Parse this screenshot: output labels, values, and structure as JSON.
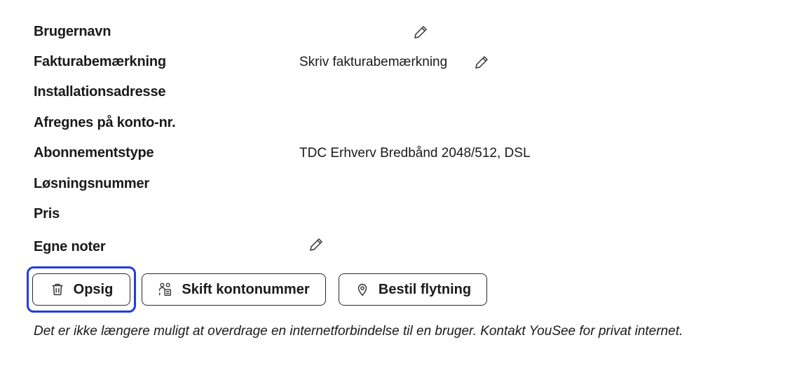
{
  "fields": [
    {
      "label": "Brugernavn",
      "value": "",
      "editable": true
    },
    {
      "label": "Fakturabemærkning",
      "value": "Skriv fakturabemærkning",
      "editable": true
    },
    {
      "label": "Installationsadresse",
      "value": "",
      "editable": false
    },
    {
      "label": "Afregnes på konto-nr.",
      "value": "",
      "editable": false
    },
    {
      "label": "Abonnementstype",
      "value": "TDC Erhverv Bredbånd 2048/512, DSL",
      "editable": false
    },
    {
      "label": "Løsningsnummer",
      "value": "",
      "editable": false
    },
    {
      "label": "Pris",
      "value": "",
      "editable": false
    },
    {
      "label": "Egne noter",
      "value": "",
      "editable": true
    }
  ],
  "actions": {
    "cancel_label": "Opsig",
    "change_account_label": "Skift kontonummer",
    "order_move_label": "Bestil flytning"
  },
  "info_text": "Det er ikke længere muligt at overdrage en internetforbindelse til en bruger. Kontakt YouSee for privat internet.",
  "icons": {
    "edit": "pencil-icon",
    "cancel": "trash-icon",
    "change_account": "users-document-icon",
    "order_move": "location-pin-icon"
  },
  "colors": {
    "focus": "#1f3fd6",
    "text": "#1a1a1a"
  }
}
